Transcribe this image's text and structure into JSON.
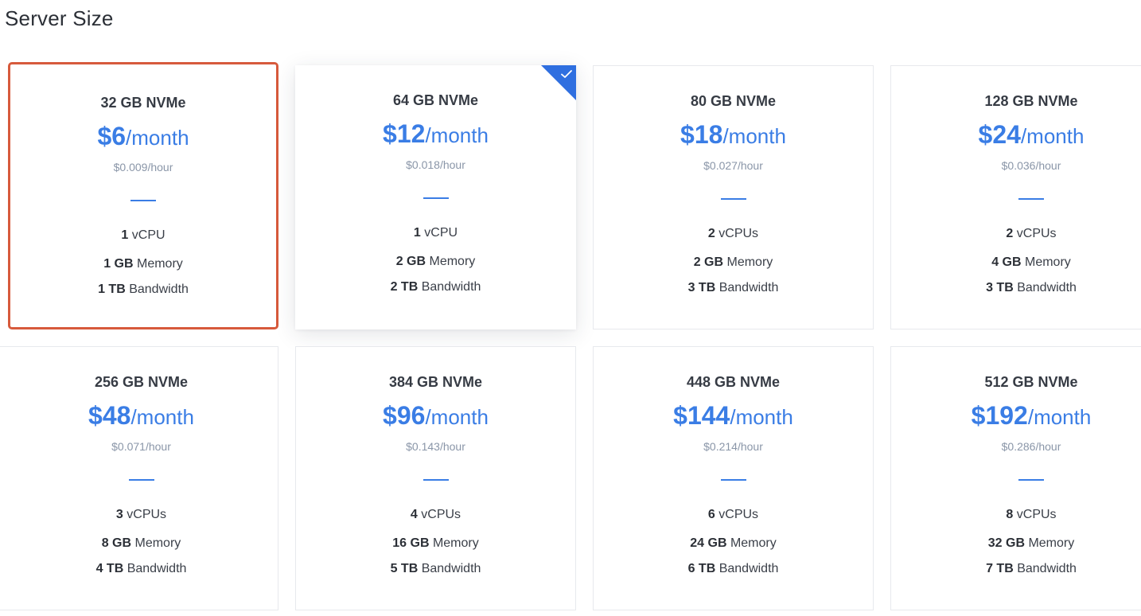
{
  "section_title": "Server Size",
  "colors": {
    "accent": "#3a7de5",
    "selected_badge": "#2f6fe0",
    "highlight_border": "#d75a3c",
    "hourly_text": "#8a96a8"
  },
  "plans": [
    {
      "storage": "32 GB NVMe",
      "price": "$6",
      "per": "/month",
      "hourly": "$0.009/hour",
      "cpu_num": "1",
      "cpu_unit": " vCPU",
      "mem_num": "1 GB",
      "mem_unit": " Memory",
      "bw_num": "1 TB",
      "bw_unit": " Bandwidth",
      "state": "highlighted"
    },
    {
      "storage": "64 GB NVMe",
      "price": "$12",
      "per": "/month",
      "hourly": "$0.018/hour",
      "cpu_num": "1",
      "cpu_unit": " vCPU",
      "mem_num": "2 GB",
      "mem_unit": " Memory",
      "bw_num": "2 TB",
      "bw_unit": " Bandwidth",
      "state": "selected",
      "badge_icon": "checkmark-icon"
    },
    {
      "storage": "80 GB NVMe",
      "price": "$18",
      "per": "/month",
      "hourly": "$0.027/hour",
      "cpu_num": "2",
      "cpu_unit": " vCPUs",
      "mem_num": "2 GB",
      "mem_unit": " Memory",
      "bw_num": "3 TB",
      "bw_unit": " Bandwidth",
      "state": "default"
    },
    {
      "storage": "128 GB NVMe",
      "price": "$24",
      "per": "/month",
      "hourly": "$0.036/hour",
      "cpu_num": "2",
      "cpu_unit": " vCPUs",
      "mem_num": "4 GB",
      "mem_unit": " Memory",
      "bw_num": "3 TB",
      "bw_unit": " Bandwidth",
      "state": "default"
    },
    {
      "storage": "256 GB NVMe",
      "price": "$48",
      "per": "/month",
      "hourly": "$0.071/hour",
      "cpu_num": "3",
      "cpu_unit": " vCPUs",
      "mem_num": "8 GB",
      "mem_unit": " Memory",
      "bw_num": "4 TB",
      "bw_unit": " Bandwidth",
      "state": "default"
    },
    {
      "storage": "384 GB NVMe",
      "price": "$96",
      "per": "/month",
      "hourly": "$0.143/hour",
      "cpu_num": "4",
      "cpu_unit": " vCPUs",
      "mem_num": "16 GB",
      "mem_unit": " Memory",
      "bw_num": "5 TB",
      "bw_unit": " Bandwidth",
      "state": "default"
    },
    {
      "storage": "448 GB NVMe",
      "price": "$144",
      "per": "/month",
      "hourly": "$0.214/hour",
      "cpu_num": "6",
      "cpu_unit": " vCPUs",
      "mem_num": "24 GB",
      "mem_unit": " Memory",
      "bw_num": "6 TB",
      "bw_unit": " Bandwidth",
      "state": "default"
    },
    {
      "storage": "512 GB NVMe",
      "price": "$192",
      "per": "/month",
      "hourly": "$0.286/hour",
      "cpu_num": "8",
      "cpu_unit": " vCPUs",
      "mem_num": "32 GB",
      "mem_unit": " Memory",
      "bw_num": "7 TB",
      "bw_unit": " Bandwidth",
      "state": "default"
    }
  ]
}
